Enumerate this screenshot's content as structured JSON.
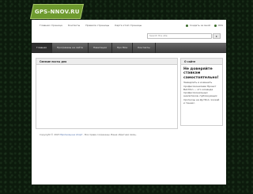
{
  "logo": {
    "text": "GPS-NNOV.RU"
  },
  "topbar": {
    "links": [
      "Главная страница",
      "Контакты",
      "Правила страницы",
      "Карта этой страницы"
    ],
    "user": {
      "login": "Создать за мной",
      "rss": "RSS"
    }
  },
  "search": {
    "placeholder": "Search the site",
    "button": "▸"
  },
  "nav": {
    "tabs": [
      "Главная",
      "Программы на сайте",
      "Навигация",
      "Про Мои",
      "Контакты"
    ]
  },
  "main": {
    "header": "Свежие посты дня"
  },
  "sidebar": {
    "header": "О сайте",
    "title": "Не доверяйте ставкам самостоятельно!",
    "text": "Замедлить и изменить профессионалами Проект Bet-Mon — это команда профессиональных аналитиков, публикующих прогнозы на футбол, хоккей и теннис."
  },
  "footer": {
    "prefix": "Copyright © 2023",
    "link": "Прогнозы на спорт",
    "suffix": ". Все права сохранены. Ваша обратная связь."
  }
}
